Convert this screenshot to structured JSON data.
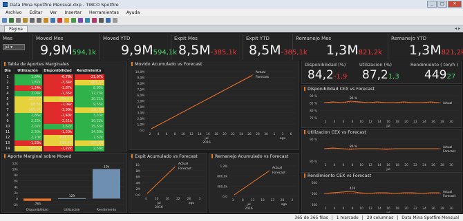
{
  "window": {
    "title": "Data Mina Spotfire Mensual.dxp - TIBCO Spotfire",
    "buttons": [
      "_",
      "□",
      "✕"
    ]
  },
  "menu": [
    "Archivo",
    "Editar",
    "Ver",
    "Insertar",
    "Herramientas",
    "Ayuda"
  ],
  "tab": {
    "label": "Página",
    "nav": "◂ ▸"
  },
  "kpis": [
    {
      "label": "Mes",
      "main": "",
      "delta": ""
    },
    {
      "label": "Moved Mes",
      "main": "9,9M",
      "delta": "594,1k",
      "sign": "green"
    },
    {
      "label": "Moved YTD",
      "main": "9,9M",
      "delta": "594,1k",
      "sign": "green"
    },
    {
      "label": "Expit Mes",
      "main": "8,5M",
      "delta": "-385,1k",
      "sign": "red"
    },
    {
      "label": "Expit YTD",
      "main": "8,5M",
      "delta": "-385,1k",
      "sign": "red"
    },
    {
      "label": "Remanejo Mes",
      "main": "1,3M",
      "delta": "821,2k",
      "sign": "red"
    },
    {
      "label": "Remanejo YTD",
      "main": "1,3M",
      "delta": "821,2k",
      "sign": "red"
    }
  ],
  "month_select": "jul",
  "table": {
    "title": "Tabla de Aportes Marginales",
    "headers": [
      "Día",
      "Utilización",
      "Disponibilidad",
      "Rendimiento"
    ],
    "rows": [
      [
        "1",
        "1,84k",
        "-6,78k",
        "-21,97k"
      ],
      [
        "2",
        "1,87k",
        "-3,34k",
        "481,32"
      ],
      [
        "3",
        "-1,24k",
        "-1,87k",
        "8,95k"
      ],
      [
        "4",
        "2,04k",
        "-1,35k",
        "17,73k"
      ],
      [
        "5",
        "127,57",
        "-754,77",
        "10,21k"
      ],
      [
        "6",
        "68,54",
        "-7,04k",
        "9,55k"
      ],
      [
        "7",
        "-165,36",
        "-3,99k",
        "-120,88"
      ],
      [
        "8",
        "2,86k",
        "-1,40k",
        "3,33k"
      ],
      [
        "9",
        "2,22k",
        "-2,51k",
        "10,22k"
      ],
      [
        "10",
        "2,07k",
        "1,67k",
        "15,53k"
      ],
      [
        "11",
        "2,30k",
        "-1,20k",
        "14,30k"
      ],
      [
        "12",
        "2,10k",
        "-891,70",
        "7,52k"
      ],
      [
        "13",
        "-1,53k",
        "696,42",
        "-159,88"
      ],
      [
        "14",
        "804,07",
        "-1,22k",
        "2,58k"
      ]
    ]
  },
  "aporte": {
    "title": "Aporte Marginal sobre Moved",
    "yticks": [
      "12k",
      "10k",
      "8k",
      "6k",
      "4k",
      "2k",
      "0",
      "-2k"
    ],
    "bars": [
      {
        "label": "Disponibilidad",
        "value": -765,
        "text": "-765"
      },
      {
        "label": "Utilización",
        "value": 129,
        "text": "129"
      },
      {
        "label": "Rendimiento",
        "value": 10000,
        "text": "10k"
      }
    ]
  },
  "movido": {
    "title": "Movido Acumulado vs Forecast",
    "yticks": [
      "10,0M",
      "9,0M",
      "8,0M",
      "7,5M",
      "6,0M",
      "5,0M",
      "4,0M",
      "3,0M",
      "2,0M",
      "1,0M",
      "0,0"
    ],
    "xticks": [
      "2",
      "4",
      "6",
      "8",
      "10",
      "12",
      "14",
      "16",
      "18",
      "20",
      "22",
      "24",
      "26",
      "28",
      "30",
      "1",
      "3",
      "6"
    ],
    "xlabel1": "jul",
    "xlabel2": "ago",
    "year": "2016",
    "legend": [
      "Actual",
      "Forecast"
    ]
  },
  "expit": {
    "title": "Expit Acumulado vs Forecast",
    "yticks": [
      "10,",
      "8M",
      "6M",
      "4M",
      "2M",
      "0,0"
    ],
    "xticks": [
      "4",
      "10",
      "16",
      "22",
      "28",
      "3"
    ],
    "xlabel1": "jul",
    "xlabel2": "ago",
    "year": "2016",
    "legend": [
      "Actual",
      "Forecast"
    ]
  },
  "remanejo": {
    "title": "Remanejo Acumulado vs Forecast",
    "yticks": [
      "1,2M",
      "800,0k",
      "400,0k",
      "0,0"
    ],
    "xticks": [
      "3",
      "8",
      "13",
      "18",
      "23",
      "28",
      "2"
    ],
    "xlabel1": "jul",
    "xlabel2": "ago",
    "year": "2016",
    "legend": [
      "Actual",
      "Forecast"
    ]
  },
  "minikpis": [
    {
      "label": "Disponibilidad (%)",
      "main": "84,2",
      "delta": "-1,9",
      "sign": "red"
    },
    {
      "label": "Utilizacion (%)",
      "main": "87,2",
      "delta": "1,3",
      "sign": "green"
    },
    {
      "label": "Rendimiento ( ton/h )",
      "main": "449",
      "delta": "27",
      "sign": "green"
    }
  ],
  "cex1": {
    "title": "Disponibilidad CEX vs Forecast",
    "yticks": [
      "90 %",
      "85 %",
      "80 %",
      "75 %"
    ],
    "annot": "86 %",
    "legend": "Actual",
    "xticks": [
      "2",
      "4",
      "6",
      "8",
      "10",
      "12",
      "14",
      "16",
      "18",
      "20",
      "22",
      "24",
      "26",
      "28",
      "30"
    ],
    "xlabel": "jul"
  },
  "cex2": {
    "title": "Utilizacion CEX vs Forecast",
    "yticks": [
      "90 %",
      "80 %"
    ],
    "annot": "86 %",
    "legend": [
      "Actual",
      "Forecast"
    ],
    "xticks": [
      "2",
      "4",
      "6",
      "8",
      "10",
      "12",
      "14",
      "16",
      "18",
      "20",
      "22",
      "24",
      "26",
      "28",
      "30"
    ],
    "xlabel": "jul"
  },
  "cex3": {
    "title": "Rendimiento CEX vs Forecast",
    "yticks": [
      "600",
      "500",
      "300"
    ],
    "annot": "476",
    "legend": [
      "Actual",
      "Forecast"
    ],
    "xticks": [
      "2",
      "4",
      "6",
      "8",
      "10",
      "12",
      "14",
      "16",
      "18",
      "20",
      "22",
      "24",
      "26",
      "28",
      "30"
    ],
    "xlabel": "jul",
    "year": "2016"
  },
  "status": {
    "rows": "365 de 365 filas",
    "marked": "1 marcado",
    "cols": "29 columnas",
    "file": "Data Mina Spotfire Mensual"
  },
  "colors": {
    "green": "#2fb24a",
    "yellow": "#e6d23a",
    "red": "#e12a2a",
    "orange": "#e8742c",
    "steel": "#6e8fb0"
  }
}
